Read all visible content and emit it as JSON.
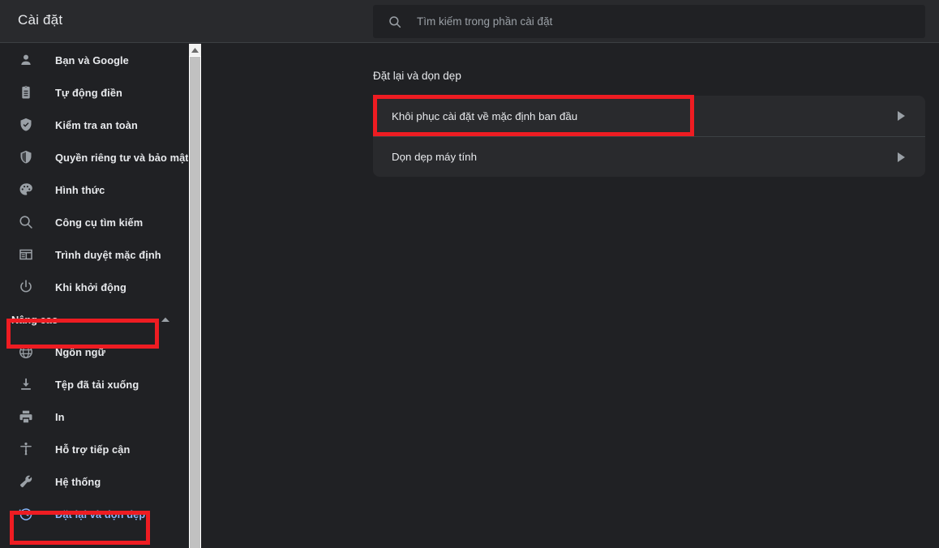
{
  "window": {
    "app_title": "Cài đặt"
  },
  "search": {
    "icon": "search-icon",
    "placeholder": "Tìm kiếm trong phần cài đặt",
    "value": ""
  },
  "sidebar": {
    "items": [
      {
        "label": "Bạn và Google",
        "icon": "person-icon",
        "selected": false
      },
      {
        "label": "Tự động điền",
        "icon": "clipboard-icon",
        "selected": false
      },
      {
        "label": "Kiểm tra an toàn",
        "icon": "shield-check-icon",
        "selected": false
      },
      {
        "label": "Quyền riêng tư và bảo mật",
        "icon": "shield-icon",
        "selected": false
      },
      {
        "label": "Hình thức",
        "icon": "palette-icon",
        "selected": false
      },
      {
        "label": "Công cụ tìm kiếm",
        "icon": "search-icon",
        "selected": false
      },
      {
        "label": "Trình duyệt mặc định",
        "icon": "browser-icon",
        "selected": false
      },
      {
        "label": "Khi khởi động",
        "icon": "power-icon",
        "selected": false
      }
    ],
    "group": {
      "label": "Nâng cao",
      "icon": "chevron-up-icon",
      "expanded": true
    },
    "advanced_items": [
      {
        "label": "Ngôn ngữ",
        "icon": "globe-icon",
        "selected": false
      },
      {
        "label": "Tệp đã tải xuống",
        "icon": "download-icon",
        "selected": false
      },
      {
        "label": "In",
        "icon": "printer-icon",
        "selected": false
      },
      {
        "label": "Hỗ trợ tiếp cận",
        "icon": "accessibility-icon",
        "selected": false
      },
      {
        "label": "Hệ thống",
        "icon": "wrench-icon",
        "selected": false
      },
      {
        "label": "Đặt lại và dọn dẹp",
        "icon": "history-reset-icon",
        "selected": true
      }
    ],
    "scrollbar": {
      "up_arrow_icon": "scroll-up-arrow-icon"
    }
  },
  "main": {
    "section_title": "Đặt lại và dọn dẹp",
    "rows": [
      {
        "label": "Khôi phục cài đặt về mặc định ban đầu",
        "arrow_icon": "chevron-right-icon"
      },
      {
        "label": "Dọn dẹp máy tính",
        "arrow_icon": "chevron-right-icon"
      }
    ]
  },
  "annotations": {
    "color": "#ee1c22",
    "boxes": [
      {
        "name": "advanced-group-highlight"
      },
      {
        "name": "reset-nav-highlight"
      },
      {
        "name": "restore-defaults-highlight"
      }
    ]
  },
  "colors": {
    "background": "#202124",
    "surface": "#292a2d",
    "accent": "#8ab4f8",
    "text": "#e8eaed",
    "muted": "#9aa0a6",
    "divider": "#3c4043",
    "annotation": "#ee1c22"
  }
}
